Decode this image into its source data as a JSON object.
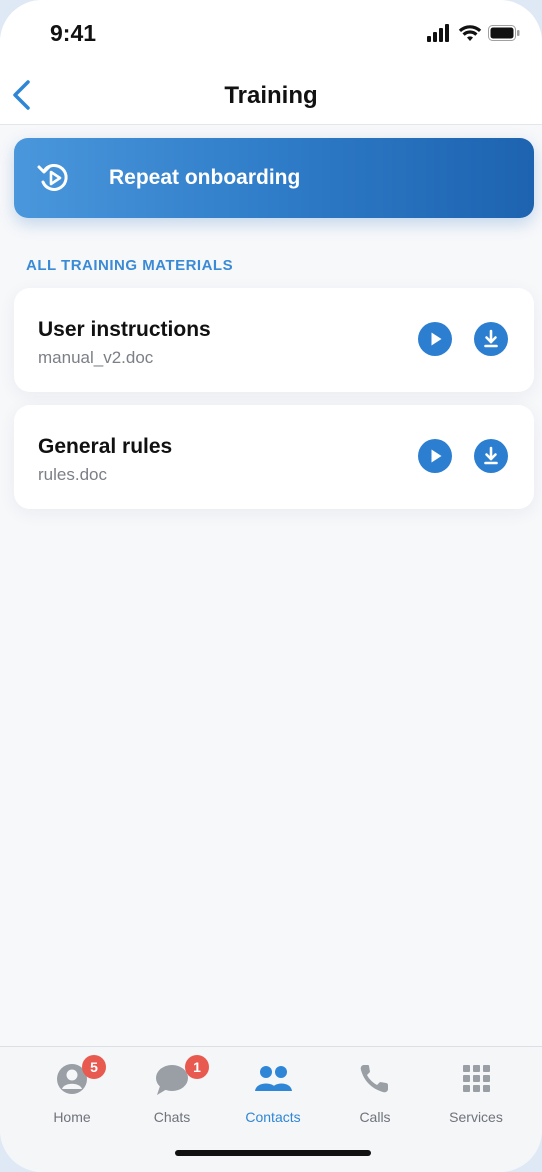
{
  "status_bar": {
    "time": "9:41"
  },
  "nav": {
    "title": "Training"
  },
  "banner": {
    "label": "Repeat onboarding",
    "icon": "replay-play-icon"
  },
  "section": {
    "label": "ALL TRAINING MATERIALS"
  },
  "materials": [
    {
      "title": "User instructions",
      "file": "manual_v2.doc"
    },
    {
      "title": "General rules",
      "file": "rules.doc"
    }
  ],
  "tabbar": {
    "tabs": [
      {
        "label": "Home",
        "icon": "person-icon",
        "badge": "5"
      },
      {
        "label": "Chats",
        "icon": "chat-bubble-icon",
        "badge": "1"
      },
      {
        "label": "Contacts",
        "icon": "people-icon",
        "active": true
      },
      {
        "label": "Calls",
        "icon": "phone-icon"
      },
      {
        "label": "Services",
        "icon": "grid-icon"
      }
    ]
  },
  "colors": {
    "accent": "#2b7ed0",
    "banner_start": "#4a97dc",
    "banner_end": "#1d63b0",
    "badge": "#e85a4f",
    "section_label": "#3a8ad6"
  }
}
